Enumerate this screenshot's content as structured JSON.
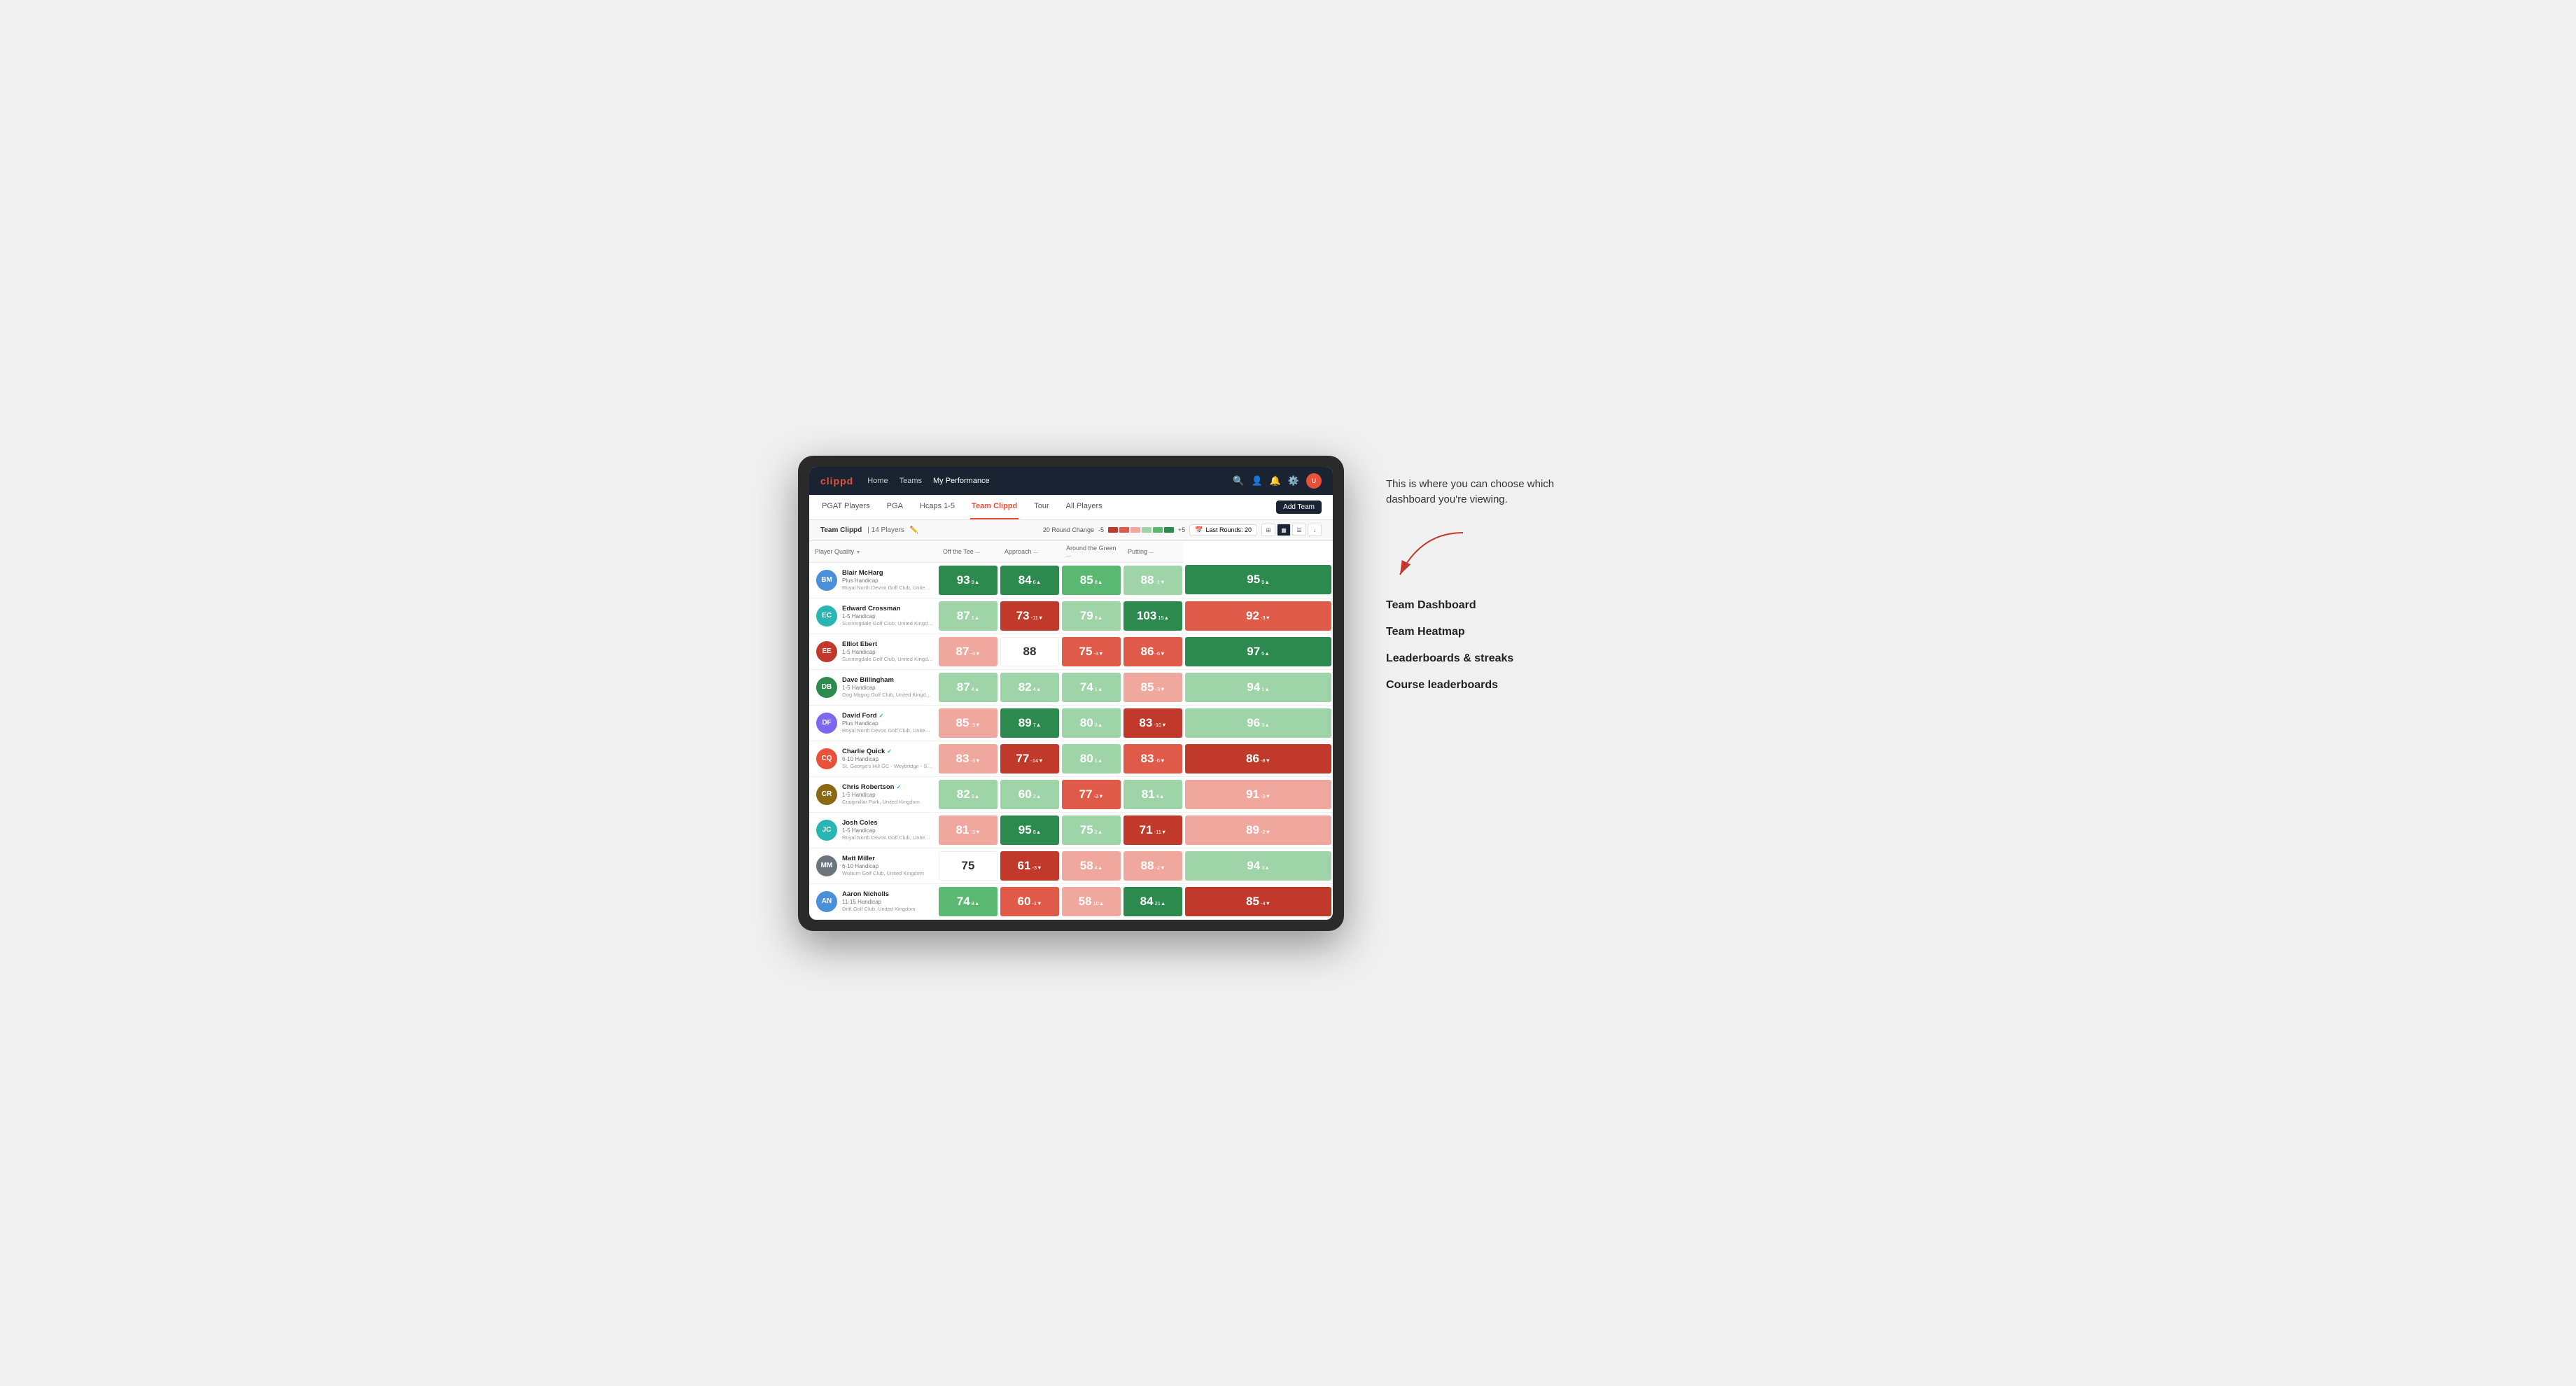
{
  "annotation": {
    "description": "This is where you can choose which dashboard you're viewing.",
    "options": [
      {
        "label": "Team Dashboard"
      },
      {
        "label": "Team Heatmap"
      },
      {
        "label": "Leaderboards & streaks"
      },
      {
        "label": "Course leaderboards"
      }
    ]
  },
  "navbar": {
    "logo": "clippd",
    "links": [
      {
        "label": "Home",
        "active": false
      },
      {
        "label": "Teams",
        "active": false
      },
      {
        "label": "My Performance",
        "active": true
      }
    ],
    "add_team_label": "Add Team"
  },
  "subnav": {
    "tabs": [
      {
        "label": "PGAT Players",
        "active": false
      },
      {
        "label": "PGA",
        "active": false
      },
      {
        "label": "Hcaps 1-5",
        "active": false
      },
      {
        "label": "Team Clippd",
        "active": true
      },
      {
        "label": "Tour",
        "active": false
      },
      {
        "label": "All Players",
        "active": false
      }
    ]
  },
  "team_header": {
    "name": "Team Clippd",
    "separator": "|",
    "count": "14 Players",
    "round_change_label": "20 Round Change",
    "range_min": "-5",
    "range_max": "+5",
    "last_rounds_label": "Last Rounds:",
    "last_rounds_value": "20"
  },
  "table": {
    "columns": {
      "player_quality": "Player Quality",
      "off_tee": "Off the Tee",
      "approach": "Approach",
      "around_green": "Around the Green",
      "putting": "Putting"
    },
    "players": [
      {
        "name": "Blair McHarg",
        "handicap": "Plus Handicap",
        "club": "Royal North Devon Golf Club, United Kingdom",
        "avatar_initials": "BM",
        "avatar_color": "av-blue",
        "scores": [
          {
            "value": "93",
            "change": "9▲",
            "color": "bg-dark-green"
          },
          {
            "value": "84",
            "change": "6▲",
            "color": "bg-dark-green"
          },
          {
            "value": "85",
            "change": "8▲",
            "color": "bg-med-green"
          },
          {
            "value": "88",
            "change": "-1▼",
            "color": "bg-light-green"
          },
          {
            "value": "95",
            "change": "9▲",
            "color": "bg-dark-green"
          }
        ]
      },
      {
        "name": "Edward Crossman",
        "handicap": "1-5 Handicap",
        "club": "Sunningdale Golf Club, United Kingdom",
        "avatar_initials": "EC",
        "avatar_color": "av-teal",
        "scores": [
          {
            "value": "87",
            "change": "1▲",
            "color": "bg-light-green"
          },
          {
            "value": "73",
            "change": "-11▼",
            "color": "bg-dark-red"
          },
          {
            "value": "79",
            "change": "9▲",
            "color": "bg-light-green"
          },
          {
            "value": "103",
            "change": "15▲",
            "color": "bg-dark-green"
          },
          {
            "value": "92",
            "change": "-3▼",
            "color": "bg-med-red"
          }
        ]
      },
      {
        "name": "Elliot Ebert",
        "handicap": "1-5 Handicap",
        "club": "Sunningdale Golf Club, United Kingdom",
        "avatar_initials": "EE",
        "avatar_color": "av-red",
        "scores": [
          {
            "value": "87",
            "change": "-3▼",
            "color": "bg-light-red"
          },
          {
            "value": "88",
            "change": "",
            "color": "bg-white"
          },
          {
            "value": "75",
            "change": "-3▼",
            "color": "bg-med-red"
          },
          {
            "value": "86",
            "change": "-6▼",
            "color": "bg-med-red"
          },
          {
            "value": "97",
            "change": "5▲",
            "color": "bg-dark-green"
          }
        ]
      },
      {
        "name": "Dave Billingham",
        "handicap": "1-5 Handicap",
        "club": "Gog Magog Golf Club, United Kingdom",
        "avatar_initials": "DB",
        "avatar_color": "av-green",
        "scores": [
          {
            "value": "87",
            "change": "4▲",
            "color": "bg-light-green"
          },
          {
            "value": "82",
            "change": "4▲",
            "color": "bg-light-green"
          },
          {
            "value": "74",
            "change": "1▲",
            "color": "bg-light-green"
          },
          {
            "value": "85",
            "change": "-3▼",
            "color": "bg-light-red"
          },
          {
            "value": "94",
            "change": "1▲",
            "color": "bg-light-green"
          }
        ]
      },
      {
        "name": "David Ford",
        "handicap": "Plus Handicap",
        "club": "Royal North Devon Golf Club, United Kingdom",
        "avatar_initials": "DF",
        "avatar_color": "av-purple",
        "verified": true,
        "scores": [
          {
            "value": "85",
            "change": "-3▼",
            "color": "bg-light-red"
          },
          {
            "value": "89",
            "change": "7▲",
            "color": "bg-dark-green"
          },
          {
            "value": "80",
            "change": "3▲",
            "color": "bg-light-green"
          },
          {
            "value": "83",
            "change": "-10▼",
            "color": "bg-dark-red"
          },
          {
            "value": "96",
            "change": "3▲",
            "color": "bg-light-green"
          }
        ]
      },
      {
        "name": "Charlie Quick",
        "handicap": "6-10 Handicap",
        "club": "St. George's Hill GC - Weybridge - Surrey, Uni...",
        "avatar_initials": "CQ",
        "avatar_color": "av-orange",
        "verified": true,
        "scores": [
          {
            "value": "83",
            "change": "-3▼",
            "color": "bg-light-red"
          },
          {
            "value": "77",
            "change": "-14▼",
            "color": "bg-dark-red"
          },
          {
            "value": "80",
            "change": "1▲",
            "color": "bg-light-green"
          },
          {
            "value": "83",
            "change": "-6▼",
            "color": "bg-med-red"
          },
          {
            "value": "86",
            "change": "-8▼",
            "color": "bg-dark-red"
          }
        ]
      },
      {
        "name": "Chris Robertson",
        "handicap": "1-5 Handicap",
        "club": "Craigmillar Park, United Kingdom",
        "avatar_initials": "CR",
        "avatar_color": "av-brown",
        "verified": true,
        "scores": [
          {
            "value": "82",
            "change": "3▲",
            "color": "bg-light-green"
          },
          {
            "value": "60",
            "change": "2▲",
            "color": "bg-light-green"
          },
          {
            "value": "77",
            "change": "-3▼",
            "color": "bg-med-red"
          },
          {
            "value": "81",
            "change": "4▲",
            "color": "bg-light-green"
          },
          {
            "value": "91",
            "change": "-3▼",
            "color": "bg-light-red"
          }
        ]
      },
      {
        "name": "Josh Coles",
        "handicap": "1-5 Handicap",
        "club": "Royal North Devon Golf Club, United Kingdom",
        "avatar_initials": "JC",
        "avatar_color": "av-teal",
        "scores": [
          {
            "value": "81",
            "change": "-3▼",
            "color": "bg-light-red"
          },
          {
            "value": "95",
            "change": "8▲",
            "color": "bg-dark-green"
          },
          {
            "value": "75",
            "change": "2▲",
            "color": "bg-light-green"
          },
          {
            "value": "71",
            "change": "-11▼",
            "color": "bg-dark-red"
          },
          {
            "value": "89",
            "change": "-2▼",
            "color": "bg-light-red"
          }
        ]
      },
      {
        "name": "Matt Miller",
        "handicap": "6-10 Handicap",
        "club": "Woburn Golf Club, United Kingdom",
        "avatar_initials": "MM",
        "avatar_color": "av-gray",
        "scores": [
          {
            "value": "75",
            "change": "",
            "color": "bg-white"
          },
          {
            "value": "61",
            "change": "-3▼",
            "color": "bg-dark-red"
          },
          {
            "value": "58",
            "change": "4▲",
            "color": "bg-light-red"
          },
          {
            "value": "88",
            "change": "-2▼",
            "color": "bg-light-red"
          },
          {
            "value": "94",
            "change": "3▲",
            "color": "bg-light-green"
          }
        ]
      },
      {
        "name": "Aaron Nicholls",
        "handicap": "11-15 Handicap",
        "club": "Drift Golf Club, United Kingdom",
        "avatar_initials": "AN",
        "avatar_color": "av-blue",
        "scores": [
          {
            "value": "74",
            "change": "8▲",
            "color": "bg-med-green"
          },
          {
            "value": "60",
            "change": "-1▼",
            "color": "bg-med-red"
          },
          {
            "value": "58",
            "change": "10▲",
            "color": "bg-light-red"
          },
          {
            "value": "84",
            "change": "21▲",
            "color": "bg-dark-green"
          },
          {
            "value": "85",
            "change": "-4▼",
            "color": "bg-dark-red"
          }
        ]
      }
    ]
  }
}
